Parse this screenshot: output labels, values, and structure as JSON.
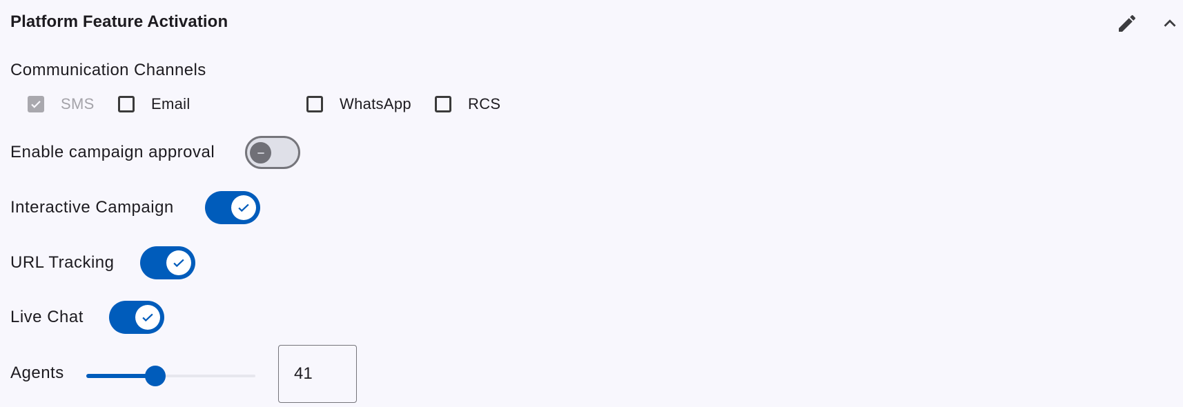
{
  "header": {
    "title": "Platform Feature Activation",
    "edit_icon": "pencil-icon",
    "collapse_icon": "chevron-up-icon"
  },
  "communication_channels": {
    "label": "Communication Channels",
    "options": [
      {
        "label": "SMS",
        "checked": true,
        "disabled": true
      },
      {
        "label": "Email",
        "checked": false,
        "disabled": false
      },
      {
        "label": "WhatsApp",
        "checked": false,
        "disabled": false
      },
      {
        "label": "RCS",
        "checked": false,
        "disabled": false
      }
    ]
  },
  "toggles": [
    {
      "label": "Enable campaign approval",
      "enabled": false
    },
    {
      "label": "Interactive Campaign",
      "enabled": true
    },
    {
      "label": "URL Tracking",
      "enabled": true
    },
    {
      "label": "Live Chat",
      "enabled": true
    }
  ],
  "agents": {
    "label": "Agents",
    "value": "41",
    "slider_fraction": 0.41
  },
  "colors": {
    "accent": "#005cbb",
    "background": "#f8f7fd",
    "disabled_text": "#a4a3a9"
  }
}
